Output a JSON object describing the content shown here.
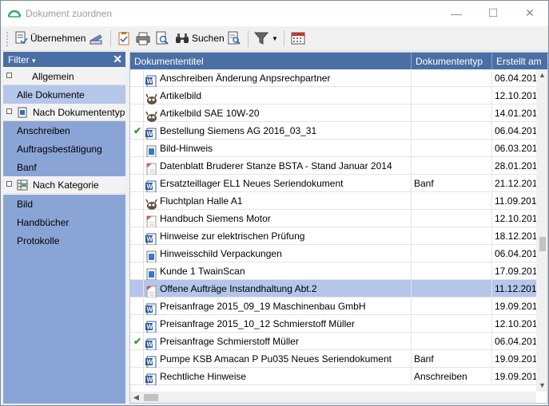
{
  "window": {
    "title": "Dokument zuordnen",
    "minimize_glyph": "—",
    "maximize_glyph": "☐",
    "close_glyph": "✕"
  },
  "toolbar": {
    "assign_label": "Übernehmen",
    "search_label": "Suchen",
    "icons": [
      "assign-icon",
      "scanner-icon",
      "checklist-icon",
      "print-icon",
      "print-preview-icon",
      "binoculars-icon",
      "search-document-icon",
      "filter-icon",
      "calendar-icon"
    ]
  },
  "filter": {
    "header": "Filter",
    "header_arrow": "▾",
    "close": "✕",
    "groups": [
      {
        "label": "Allgemein",
        "items": [
          "Alle Dokumente"
        ]
      },
      {
        "label": "Nach Dokumententyp",
        "items": [
          "Anschreiben",
          "Auftragsbestätigung",
          "Banf"
        ]
      },
      {
        "label": "Nach Kategorie",
        "items": [
          "Bild",
          "Handbücher",
          "Protokolle"
        ]
      }
    ],
    "selected_item": "Alle Dokumente"
  },
  "grid": {
    "columns": [
      "Dokumententitel",
      "Dokumententyp",
      "Erstellt am"
    ],
    "rows": [
      {
        "icon": "word-icon",
        "check": false,
        "title": "Anschreiben Änderung Anpsrechpartner",
        "type": "",
        "created": "06.04.201"
      },
      {
        "icon": "gimp-icon",
        "check": false,
        "title": "Artikelbild",
        "type": "",
        "created": "12.10.201"
      },
      {
        "icon": "gimp-icon",
        "check": false,
        "title": "Artikelbild SAE 10W-20",
        "type": "",
        "created": "14.01.201"
      },
      {
        "icon": "word-icon",
        "check": true,
        "title": "Bestellung Siemens AG 2016_03_31",
        "type": "",
        "created": "06.04.201"
      },
      {
        "icon": "image-icon",
        "check": false,
        "title": "Bild-Hinweis",
        "type": "",
        "created": "06.03.201"
      },
      {
        "icon": "pdf-icon",
        "check": false,
        "title": "Datenblatt Bruderer Stanze BSTA - Stand Januar 2014",
        "type": "",
        "created": "28.01.201"
      },
      {
        "icon": "word-icon",
        "check": false,
        "title": "Ersatzteillager  EL1  Neues Seriendokument",
        "type": "Banf",
        "created": "21.12.201"
      },
      {
        "icon": "gimp-icon",
        "check": false,
        "title": "Fluchtplan Halle A1",
        "type": "",
        "created": "11.09.201"
      },
      {
        "icon": "pdf-icon",
        "check": false,
        "title": "Handbuch Siemens Motor",
        "type": "",
        "created": "12.10.201"
      },
      {
        "icon": "word-icon",
        "check": false,
        "title": "Hinweise zur elektrischen Prüfung",
        "type": "",
        "created": "18.12.201"
      },
      {
        "icon": "image-icon",
        "check": false,
        "title": "Hinweisschild Verpackungen",
        "type": "",
        "created": "06.04.201"
      },
      {
        "icon": "image-icon",
        "check": false,
        "title": "Kunde 1 TwainScan",
        "type": "",
        "created": "17.09.201"
      },
      {
        "icon": "pdf-icon",
        "check": false,
        "title": "Offene Aufträge Instandhaltung Abt.2",
        "type": "",
        "created": "11.12.201"
      },
      {
        "icon": "word-icon",
        "check": false,
        "title": "Preisanfrage 2015_09_19 Maschinenbau GmbH",
        "type": "",
        "created": "19.09.201"
      },
      {
        "icon": "word-icon",
        "check": false,
        "title": "Preisanfrage 2015_10_12 Schmierstoff Müller",
        "type": "",
        "created": "12.10.201"
      },
      {
        "icon": "word-icon",
        "check": true,
        "title": "Preisanfrage Schmierstoff Müller",
        "type": "",
        "created": "06.04.201"
      },
      {
        "icon": "word-icon",
        "check": false,
        "title": "Pumpe KSB Amacan P  Pu035  Neues Seriendokument",
        "type": "Banf",
        "created": "19.09.201"
      },
      {
        "icon": "word-icon",
        "check": false,
        "title": "Rechtliche Hinweise",
        "type": "Anschreiben",
        "created": "19.09.201"
      }
    ],
    "selected_row": 12
  },
  "colors": {
    "header_blue": "#4a6fa5",
    "filter_item_blue": "#8aa4d6",
    "selection": "#b4c6e9",
    "check_green": "#2f9a2f",
    "app_icon_green": "#2bab6b"
  }
}
